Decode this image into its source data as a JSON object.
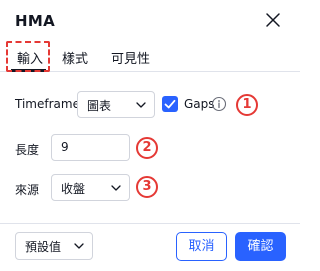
{
  "dialog": {
    "title": "HMA",
    "close_icon": "close-icon"
  },
  "tabs": [
    {
      "label": "輸入",
      "active": true
    },
    {
      "label": "樣式",
      "active": false
    },
    {
      "label": "可見性",
      "active": false
    }
  ],
  "inputs": {
    "timeframe": {
      "label": "Timeframe",
      "value": "圖表"
    },
    "gaps": {
      "label": "Gaps",
      "checked": true,
      "info_icon": "info-icon"
    },
    "length": {
      "label": "長度",
      "value": "9"
    },
    "source": {
      "label": "來源",
      "value": "收盤"
    }
  },
  "annotations": {
    "badge_1": "1",
    "badge_2": "2",
    "badge_3": "3",
    "accent_color": "#e53935"
  },
  "footer": {
    "defaults_label": "預設值",
    "cancel_label": "取消",
    "ok_label": "確認"
  },
  "colors": {
    "primary": "#2962ff",
    "text": "#131722",
    "border": "#d1d4dc"
  }
}
